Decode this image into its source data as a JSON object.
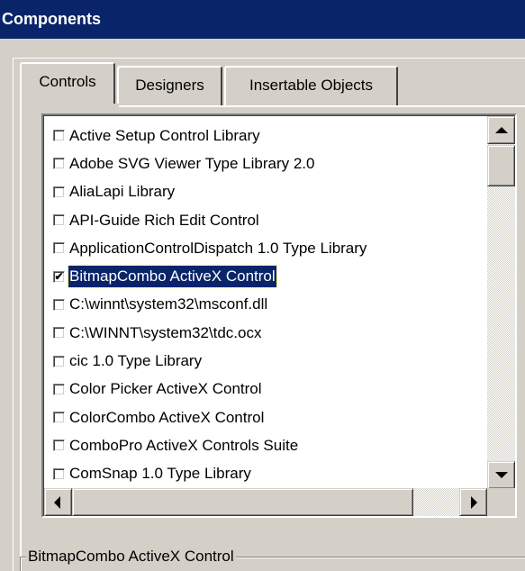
{
  "window": {
    "title": "Components"
  },
  "tabs": [
    {
      "label": "Controls",
      "active": true
    },
    {
      "label": "Designers",
      "active": false
    },
    {
      "label": "Insertable Objects",
      "active": false
    }
  ],
  "list": {
    "items": [
      {
        "label": "Active Setup Control Library",
        "checked": false
      },
      {
        "label": "Adobe SVG Viewer Type Library 2.0",
        "checked": false
      },
      {
        "label": "AliaLapi Library",
        "checked": false
      },
      {
        "label": "API-Guide Rich Edit Control",
        "checked": false
      },
      {
        "label": "ApplicationControlDispatch 1.0 Type Library",
        "checked": false
      },
      {
        "label": "BitmapCombo ActiveX Control",
        "checked": true,
        "selected": true
      },
      {
        "label": "C:\\winnt\\system32\\msconf.dll",
        "checked": false
      },
      {
        "label": "C:\\WINNT\\system32\\tdc.ocx",
        "checked": false
      },
      {
        "label": "cic 1.0 Type Library",
        "checked": false
      },
      {
        "label": "Color Picker ActiveX Control",
        "checked": false
      },
      {
        "label": "ColorCombo ActiveX Control",
        "checked": false
      },
      {
        "label": "ComboPro ActiveX Controls Suite",
        "checked": false
      },
      {
        "label": "ComSnap 1.0 Type Library",
        "checked": false
      }
    ]
  },
  "details": {
    "group_label": "BitmapCombo ActiveX Control"
  },
  "icons": {
    "scroll_up": "scroll-up-icon",
    "scroll_down": "scroll-down-icon",
    "scroll_left": "scroll-left-icon",
    "scroll_right": "scroll-right-icon",
    "checkmark": "✔"
  },
  "colors": {
    "titlebar": "#0a246a",
    "face": "#d4d0c8",
    "selection": "#0a246a"
  }
}
